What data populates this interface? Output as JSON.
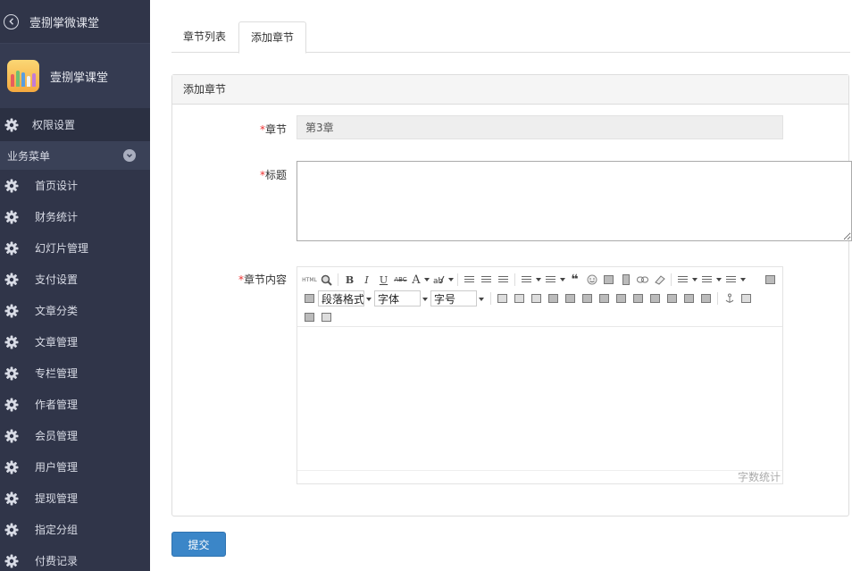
{
  "sidebar": {
    "app_title": "壹捌掌微课堂",
    "brand_name": "壹捌掌课堂",
    "permissions_label": "权限设置",
    "section_label": "业务菜单",
    "items": [
      {
        "label": "首页设计"
      },
      {
        "label": "财务统计"
      },
      {
        "label": "幻灯片管理"
      },
      {
        "label": "支付设置"
      },
      {
        "label": "文章分类"
      },
      {
        "label": "文章管理"
      },
      {
        "label": "专栏管理"
      },
      {
        "label": "作者管理"
      },
      {
        "label": "会员管理"
      },
      {
        "label": "用户管理"
      },
      {
        "label": "提现管理"
      },
      {
        "label": "指定分组"
      },
      {
        "label": "付费记录"
      }
    ]
  },
  "tabs": [
    {
      "label": "章节列表"
    },
    {
      "label": "添加章节"
    }
  ],
  "panel": {
    "title": "添加章节"
  },
  "form": {
    "required_mark": "*",
    "chapter_label": "章节",
    "chapter_value": "第3章",
    "title_label": "标题",
    "content_label": "章节内容"
  },
  "editor": {
    "html_label": "HTML",
    "bold": "B",
    "italic": "I",
    "underline": "U",
    "strike": "ABC",
    "font_color": "A",
    "quote": "❝",
    "paragraph_format": "段落格式",
    "font_family": "字体",
    "font_size": "字号",
    "word_count": "字数统计"
  },
  "submit_label": "提交",
  "colors": {
    "sidebar_bg": "#303549",
    "accent": "#3b86c8",
    "required": "#ee3333"
  }
}
